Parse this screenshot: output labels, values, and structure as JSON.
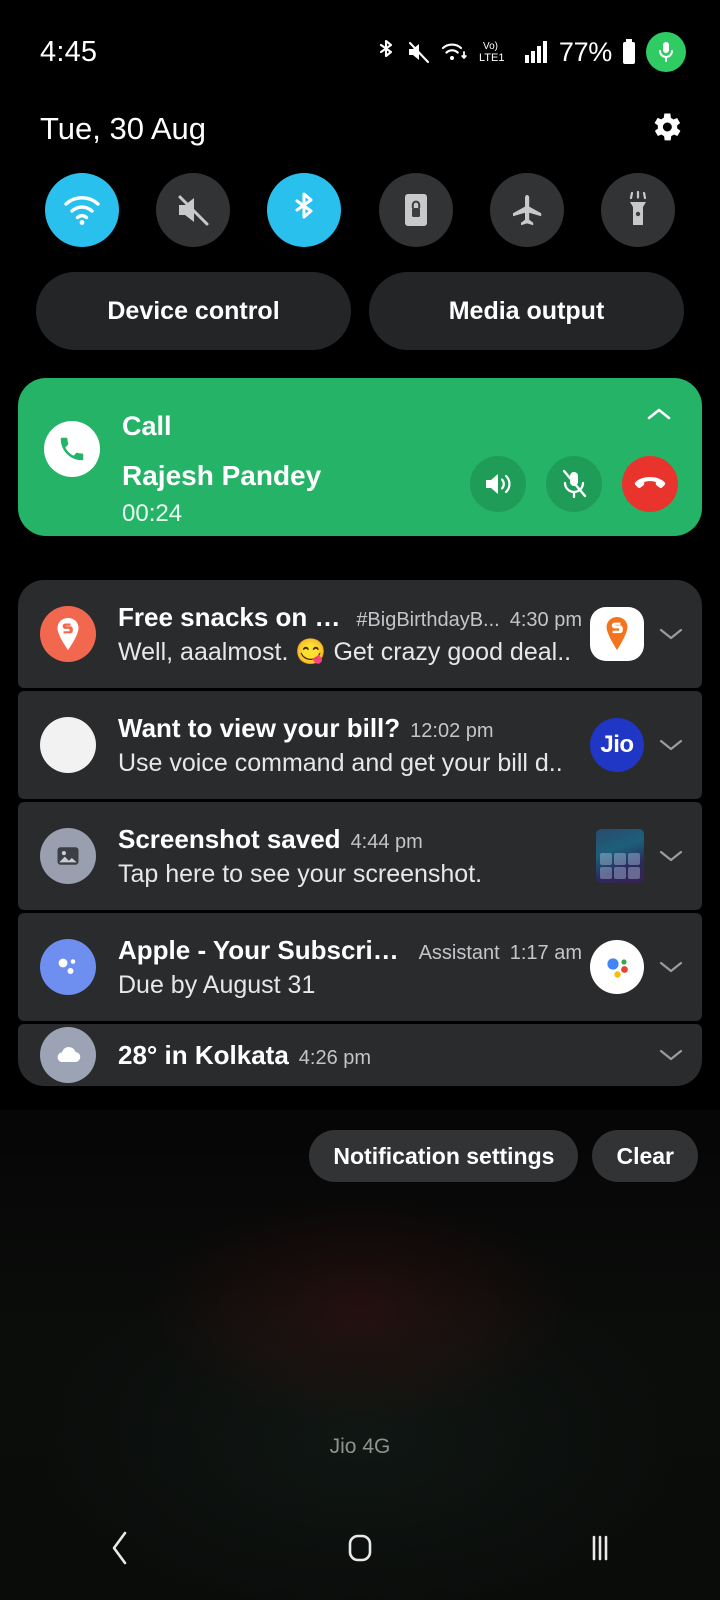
{
  "status_bar": {
    "clock": "4:45",
    "battery_percent": "77%",
    "network_label": "LTE1",
    "volte_label": "Vo)",
    "icons": [
      "bluetooth-icon",
      "mute-icon",
      "wifi-icon",
      "volte-icon",
      "signal-icon",
      "battery-icon",
      "mic-recording-icon"
    ]
  },
  "header": {
    "date": "Tue, 30 Aug",
    "settings_icon": "gear-icon"
  },
  "quick_settings": [
    {
      "name": "wifi",
      "icon": "wifi-icon",
      "active": true
    },
    {
      "name": "sound",
      "icon": "mute-icon",
      "active": false
    },
    {
      "name": "bluetooth",
      "icon": "bluetooth-icon",
      "active": true
    },
    {
      "name": "auto-rotate",
      "icon": "screen-lock-icon",
      "active": false
    },
    {
      "name": "airplane-mode",
      "icon": "airplane-icon",
      "active": false
    },
    {
      "name": "flashlight",
      "icon": "flashlight-icon",
      "active": false
    }
  ],
  "pills": {
    "device_control": "Device control",
    "media_output": "Media output"
  },
  "call": {
    "label": "Call",
    "contact": "Rajesh Pandey",
    "duration": "00:24",
    "accent_color": "#25b467",
    "end_color": "#e8342d",
    "actions": [
      "speaker-icon",
      "mic-mute-icon",
      "end-call-icon"
    ]
  },
  "notifications": [
    {
      "app": "swiggy",
      "title": "Free snacks on our...",
      "meta": "#BigBirthdayB...",
      "time": "4:30 pm",
      "body": "Well, aaalmost. 😋 Get crazy good deal..",
      "avatar_color": "#f2684f",
      "badge": "swiggy-icon"
    },
    {
      "app": "jio",
      "title": "Want to view your bill?",
      "meta": "",
      "time": "12:02 pm",
      "body": "Use voice command and get your bill d..",
      "avatar_color": "#f2f2f2",
      "badge": "jio-icon",
      "badge_text": "Jio"
    },
    {
      "app": "screenshot",
      "title": "Screenshot saved",
      "meta": "",
      "time": "4:44 pm",
      "body": "Tap here to see your screenshot.",
      "avatar_color": "#9a9fb0",
      "badge": "screenshot-thumbnail"
    },
    {
      "app": "assistant",
      "title": "Apple - Your Subscriptio...",
      "meta": "Assistant",
      "time": "1:17 am",
      "body": "Due by August 31",
      "avatar_color": "#6e8ef0",
      "badge": "google-assistant-icon"
    },
    {
      "app": "weather",
      "title": "28° in Kolkata",
      "meta": "",
      "time": "4:26 pm",
      "body": "",
      "avatar_color": "#9ba3b5",
      "badge": ""
    }
  ],
  "footer": {
    "notification_settings": "Notification settings",
    "clear": "Clear"
  },
  "carrier": "Jio 4G",
  "navbar": {
    "back": "back-icon",
    "home": "home-icon",
    "recents": "recents-icon"
  }
}
